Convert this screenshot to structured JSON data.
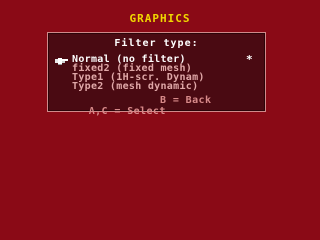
{
  "screen": {
    "title": "GRAPHICS"
  },
  "dialog": {
    "heading": "Filter type:",
    "options": [
      {
        "label": "Normal (no filter)",
        "selected": true
      },
      {
        "label": "fixed2 (fixed mesh)",
        "selected": false
      },
      {
        "label": "Type1 (1H-scr. Dynam)",
        "selected": false
      },
      {
        "label": "Type2 (mesh dynamic)",
        "selected": false
      }
    ],
    "active_marker": "*",
    "cursor_icon": "pointing-hand-icon",
    "controls": {
      "select": "A,C = Select",
      "back": "B = Back"
    }
  },
  "colors": {
    "background": "#8a0a16",
    "panel": "#4a0a12",
    "title": "#f0d900",
    "selected_text": "#ffffff",
    "dim_text": "#e0a8a8"
  }
}
